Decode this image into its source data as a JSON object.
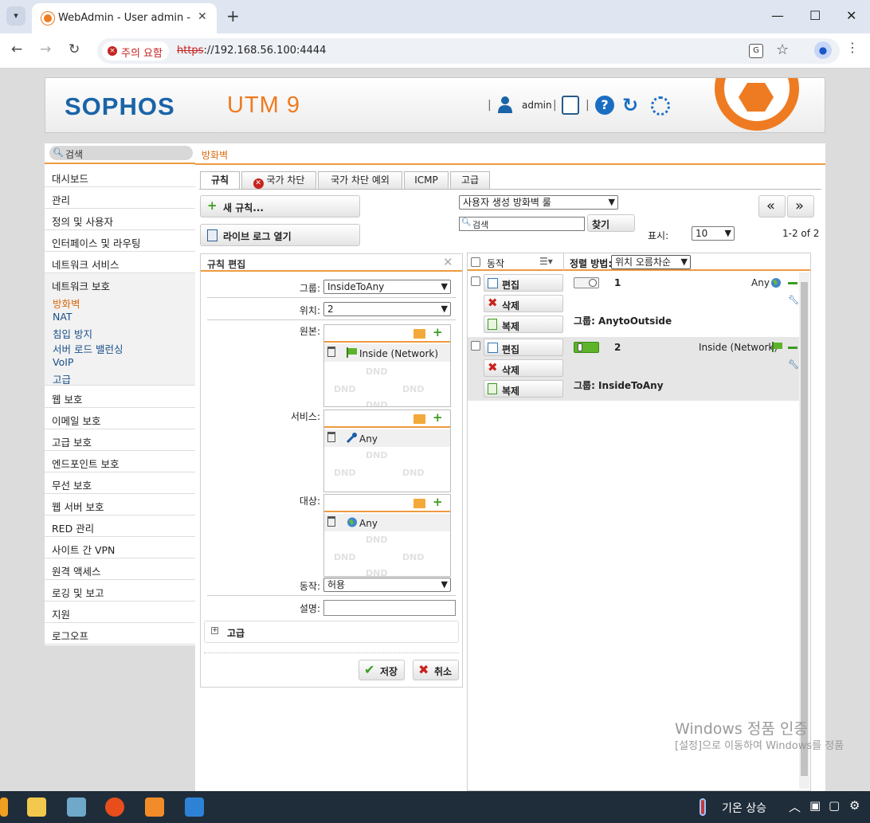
{
  "browser": {
    "tab_title": "WebAdmin - User admin - De",
    "security_label": "주의 요함",
    "url_scheme": "https",
    "url_rest": "://192.168.56.100:4444"
  },
  "header": {
    "logo": "SOPHOS",
    "product": "UTM 9",
    "user": "admin"
  },
  "sidebar": {
    "search_placeholder": "검색",
    "items_top": [
      "대시보드",
      "관리",
      "정의 및 사용자",
      "인터페이스 및 라우팅",
      "네트워크 서비스"
    ],
    "open_group": "네트워크 보호",
    "sub_items": [
      "방화벽",
      "NAT",
      "침입 방지",
      "서버 로드 밸런싱",
      "VoIP",
      "고급"
    ],
    "active_sub": "방화벽",
    "items_bottom": [
      "웹 보호",
      "이메일 보호",
      "고급 보호",
      "엔드포인트 보호",
      "무선 보호",
      "웹 서버 보호",
      "RED 관리",
      "사이트 간 VPN",
      "원격 액세스",
      "로깅 및 보고",
      "지원",
      "로그오프"
    ]
  },
  "main": {
    "breadcrumb": "방화벽",
    "tabs": [
      "규칙",
      "국가 차단",
      "국가 차단 예외",
      "ICMP",
      "고급"
    ],
    "active_tab": "규칙",
    "new_rule_label": "새 규칙...",
    "live_log_label": "라이브 로그 열기",
    "filter_select": "사용자 생성 방화벽 룰",
    "search_placeholder": "검색",
    "find_button": "찾기",
    "prev_page": "«",
    "next_page": "»",
    "display_label": "표시:",
    "display_count": "10",
    "page_range": "1-2 of 2"
  },
  "edit_rule": {
    "title": "규칙 편집",
    "group_label": "그룹:",
    "group_value": "InsideToAny",
    "position_label": "위치:",
    "position_value": "2",
    "source_label": "원본:",
    "source_item": "Inside (Network)",
    "service_label": "서비스:",
    "service_item": "Any",
    "dest_label": "대상:",
    "dest_item": "Any",
    "action_label": "동작:",
    "action_value": "허용",
    "desc_label": "설명:",
    "desc_value": "",
    "advanced_label": "고급",
    "dnd_watermark": "DND",
    "save_label": "저장",
    "cancel_label": "취소"
  },
  "rules_list": {
    "action_header": "동작",
    "sort_label": "정렬 방법:",
    "sort_value": "위치 오름차순",
    "edit_label": "편집",
    "delete_label": "삭제",
    "copy_label": "복제",
    "rules": [
      {
        "number": "1",
        "source": "Any",
        "group": "그룹: AnytoOutside",
        "enabled": false
      },
      {
        "number": "2",
        "source": "Inside (Network)",
        "group": "그룹: InsideToAny",
        "enabled": true
      }
    ]
  },
  "watermark": {
    "line1": "Windows 정품 인증",
    "line2": "[설정]으로 이동하여 Windows를 정품"
  },
  "taskbar": {
    "weather": "기온 상승"
  }
}
